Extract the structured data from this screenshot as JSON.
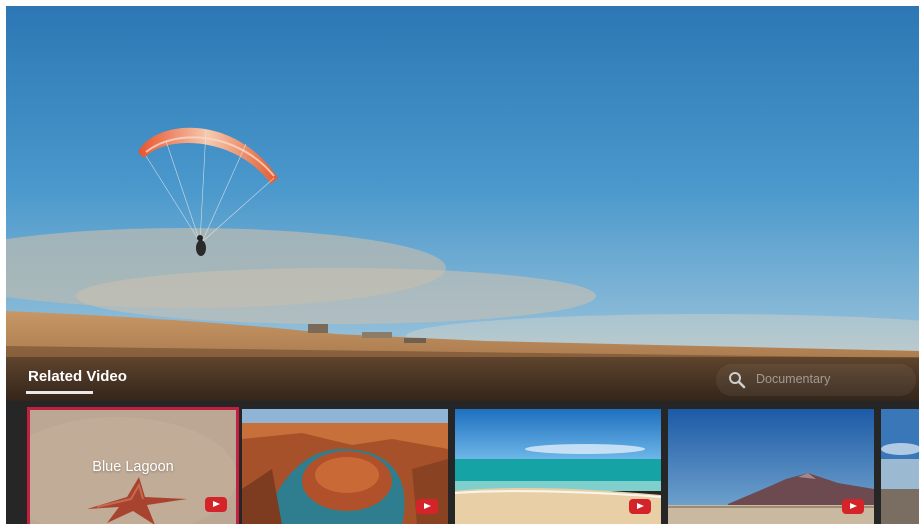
{
  "section": {
    "title": "Related Video"
  },
  "search": {
    "text": "Documentary",
    "icon": "search-icon"
  },
  "videos": [
    {
      "label": "Blue Lagoon",
      "selected": true
    },
    {
      "label": "",
      "selected": false
    },
    {
      "label": "",
      "selected": false
    },
    {
      "label": "",
      "selected": false
    },
    {
      "label": "",
      "selected": false
    }
  ],
  "colors": {
    "accent": "#c2203f",
    "youtube_red": "#d4242a",
    "strip_bg": "#262626"
  }
}
